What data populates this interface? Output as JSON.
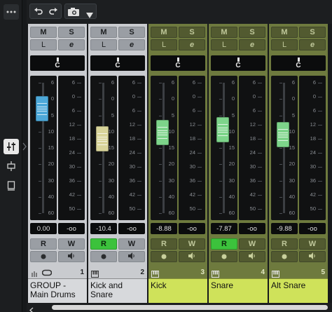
{
  "colors": {
    "group_bg": "#c9cbcf",
    "group_name_bg": "#d7d9dc",
    "instrument_bg": "#6e7a3e",
    "instrument_name_bg": "#cfe25a",
    "fader_group": "#4da8d8",
    "fader_cream": "#d8d49a",
    "fader_green": "#7dd48a",
    "read_active": "#3cc23c"
  },
  "toolbar": {
    "undo_icon": "undo-icon",
    "redo_icon": "redo-icon",
    "snapshot_icon": "camera-icon",
    "dropdown_icon": "triangle-down-icon"
  },
  "left_strip": {
    "menu_icon": "more-dots-icon",
    "mixer_icon": "faders-icon",
    "routing_icon": "routing-icon",
    "window_icon": "window-icon"
  },
  "channels": [
    {
      "number": "1",
      "name": "GROUP - Main Drums",
      "type": "group",
      "mute": "M",
      "solo": "S",
      "listen": "L",
      "edit": "e",
      "pan": "C",
      "volume": "0.00",
      "peak": "-oo",
      "read": "R",
      "write": "W",
      "read_active": false,
      "fader_level": 0.8
    },
    {
      "number": "2",
      "name": "Kick and Snare",
      "type": "group",
      "mute": "M",
      "solo": "S",
      "listen": "L",
      "edit": "e",
      "pan": "C",
      "volume": "-10.4",
      "peak": "-oo",
      "read": "R",
      "write": "W",
      "read_active": true,
      "fader_level": 0.57
    },
    {
      "number": "3",
      "name": "Kick",
      "type": "instrument",
      "mute": "M",
      "solo": "S",
      "listen": "L",
      "edit": "e",
      "pan": "C",
      "volume": "-8.88",
      "peak": "-oo",
      "read": "R",
      "write": "W",
      "read_active": false,
      "fader_level": 0.62
    },
    {
      "number": "4",
      "name": "Snare",
      "type": "instrument",
      "mute": "M",
      "solo": "S",
      "listen": "L",
      "edit": "e",
      "pan": "C",
      "volume": "-7.87",
      "peak": "-oo",
      "read": "R",
      "write": "W",
      "read_active": true,
      "fader_level": 0.64
    },
    {
      "number": "5",
      "name": "Alt Snare",
      "type": "instrument",
      "mute": "M",
      "solo": "S",
      "listen": "L",
      "edit": "e",
      "pan": "C",
      "volume": "-9.88",
      "peak": "-oo",
      "read": "R",
      "write": "W",
      "read_active": false,
      "fader_level": 0.6
    }
  ],
  "fader_scale": [
    "6",
    "0",
    "5",
    "10",
    "15",
    "20",
    "30",
    "40",
    "60"
  ],
  "meter_scale": [
    "6",
    "0",
    "6",
    "12",
    "18",
    "24",
    "30",
    "36",
    "42",
    "50"
  ]
}
